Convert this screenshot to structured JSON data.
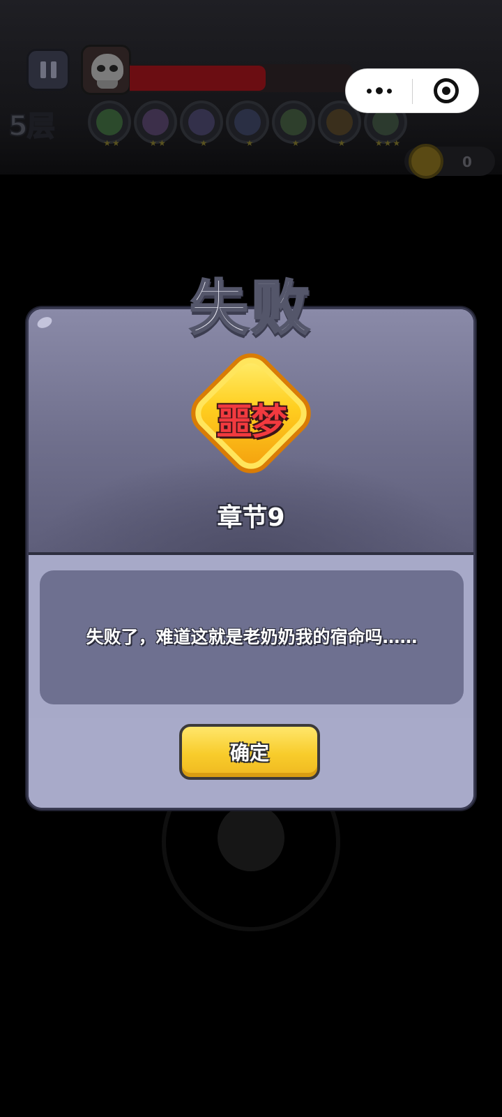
{
  "hud": {
    "floor": "5层",
    "hp_fraction": 0.61,
    "skills": [
      {
        "icon": "sword-skill-icon",
        "color": "#2c4a2c",
        "stars": "★★"
      },
      {
        "icon": "cannon-skill-icon",
        "color": "#3c2f4a",
        "stars": "★★"
      },
      {
        "icon": "arrow-skill-icon",
        "color": "#33304a",
        "stars": "★"
      },
      {
        "icon": "hat-skill-icon",
        "color": "#2a2f44",
        "stars": "★"
      },
      {
        "icon": "shield-skill-icon",
        "color": "#2e3f2c",
        "stars": "★"
      },
      {
        "icon": "star-skill-icon",
        "color": "#3a2f1c",
        "stars": "★"
      },
      {
        "icon": "dagger-skill-icon",
        "color": "#2c3a2e",
        "stars": "★★★"
      }
    ],
    "coins": "0"
  },
  "dialog": {
    "title": "失败",
    "difficulty": "噩梦",
    "chapter": "章节9",
    "message": "失败了，难道这就是老奶奶我的宿命吗……",
    "confirm_label": "确定"
  }
}
